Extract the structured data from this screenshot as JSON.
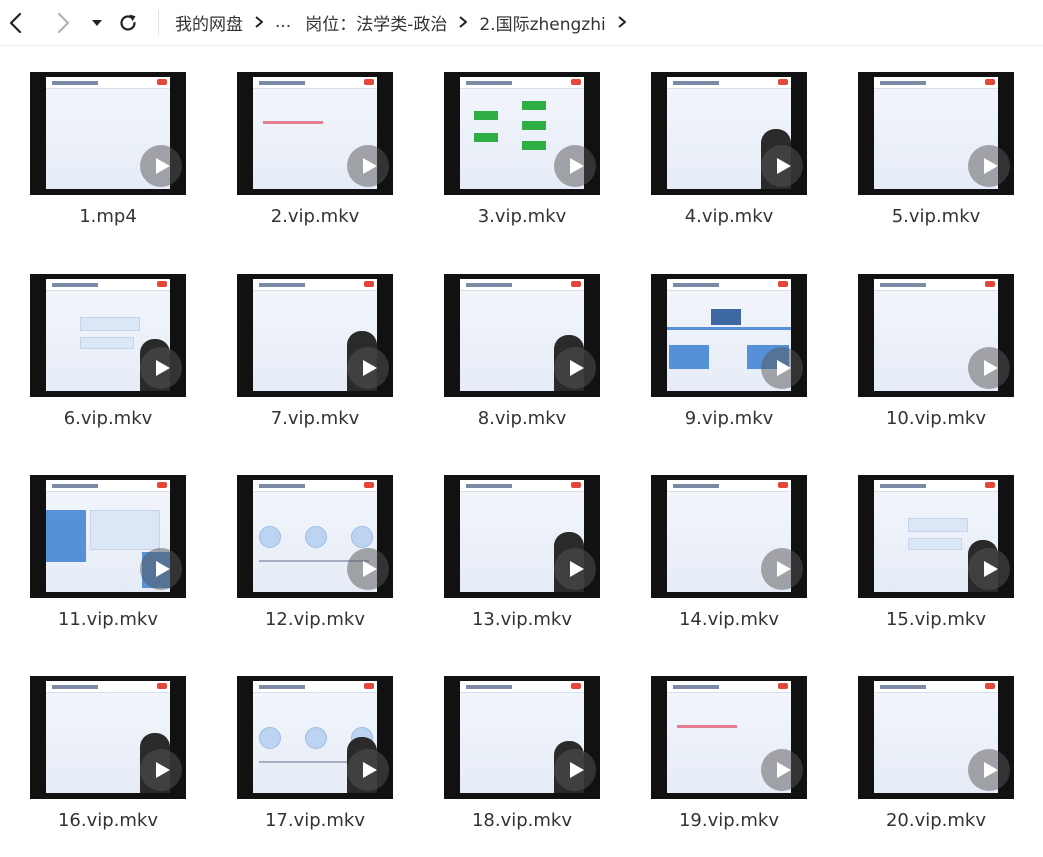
{
  "nav": {
    "back_icon": "chevron-left-icon",
    "forward_icon": "chevron-right-icon",
    "dropdown_icon": "caret-down-icon",
    "refresh_icon": "refresh-icon"
  },
  "breadcrumb": [
    {
      "label": "我的网盘"
    },
    {
      "label": "..."
    },
    {
      "label": "岗位：法学类-政治"
    },
    {
      "label": "2.国际zhengzhi"
    }
  ],
  "files": [
    {
      "name": "1.mp4",
      "variant": "text"
    },
    {
      "name": "2.vip.mkv",
      "variant": "text-red"
    },
    {
      "name": "3.vip.mkv",
      "variant": "green"
    },
    {
      "name": "4.vip.mkv",
      "variant": "text-person"
    },
    {
      "name": "5.vip.mkv",
      "variant": "text"
    },
    {
      "name": "6.vip.mkv",
      "variant": "boxes-person"
    },
    {
      "name": "7.vip.mkv",
      "variant": "text-person"
    },
    {
      "name": "8.vip.mkv",
      "variant": "text-person"
    },
    {
      "name": "9.vip.mkv",
      "variant": "timeline"
    },
    {
      "name": "10.vip.mkv",
      "variant": "text"
    },
    {
      "name": "11.vip.mkv",
      "variant": "blue"
    },
    {
      "name": "12.vip.mkv",
      "variant": "circles"
    },
    {
      "name": "13.vip.mkv",
      "variant": "text-person"
    },
    {
      "name": "14.vip.mkv",
      "variant": "text"
    },
    {
      "name": "15.vip.mkv",
      "variant": "boxes-person"
    },
    {
      "name": "16.vip.mkv",
      "variant": "text-person"
    },
    {
      "name": "17.vip.mkv",
      "variant": "circles-person"
    },
    {
      "name": "18.vip.mkv",
      "variant": "text-person"
    },
    {
      "name": "19.vip.mkv",
      "variant": "text-red"
    },
    {
      "name": "20.vip.mkv",
      "variant": "text"
    }
  ],
  "colors": {
    "play_overlay": "#555555",
    "slide_bg": "#eef2f9",
    "accent_red": "#e4473a",
    "accent_green": "#2fae44",
    "accent_blue": "#3b7fd2"
  }
}
